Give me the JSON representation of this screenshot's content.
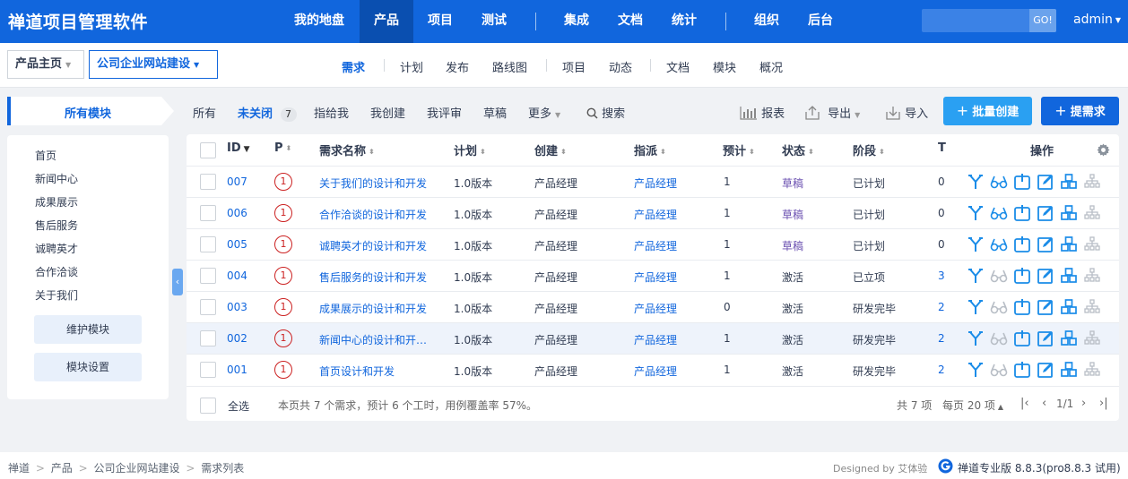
{
  "app": {
    "title": "禅道项目管理软件"
  },
  "topnav": {
    "items": [
      "我的地盘",
      "产品",
      "项目",
      "测试",
      "集成",
      "文档",
      "统计",
      "组织",
      "后台"
    ],
    "active": "产品"
  },
  "search": {
    "placeholder": "",
    "go": "GO!"
  },
  "user": {
    "name": "admin"
  },
  "breadcrumb": {
    "home": "产品主页",
    "product": "公司企业网站建设"
  },
  "subnav": {
    "items": [
      "需求",
      "计划",
      "发布",
      "路线图",
      "项目",
      "动态",
      "文档",
      "模块",
      "概况"
    ],
    "active": "需求"
  },
  "modules": {
    "title": "所有模块",
    "items": [
      "首页",
      "新闻中心",
      "成果展示",
      "售后服务",
      "诚聘英才",
      "合作洽谈",
      "关于我们"
    ],
    "maintain": "维护模块",
    "settings": "模块设置"
  },
  "filters": {
    "all": "所有",
    "unclosed": "未关闭",
    "unclosed_count": "7",
    "assigned": "指给我",
    "created": "我创建",
    "reviewed": "我评审",
    "draft": "草稿",
    "more": "更多",
    "search": "搜索"
  },
  "toolbar": {
    "report": "报表",
    "export": "导出",
    "import": "导入",
    "batch_create": "批量创建",
    "create": "提需求"
  },
  "table": {
    "headers": {
      "id": "ID",
      "p": "P",
      "name": "需求名称",
      "plan": "计划",
      "creator": "创建",
      "assign": "指派",
      "estimate": "预计",
      "status": "状态",
      "stage": "阶段",
      "t": "T",
      "actions": "操作"
    },
    "rows": [
      {
        "id": "007",
        "pri": "1",
        "name": "关于我们的设计和开发",
        "plan": "1.0版本",
        "creator": "产品经理",
        "assign": "产品经理",
        "estimate": "1",
        "status": "草稿",
        "stage": "已计划",
        "t": "0"
      },
      {
        "id": "006",
        "pri": "1",
        "name": "合作洽谈的设计和开发",
        "plan": "1.0版本",
        "creator": "产品经理",
        "assign": "产品经理",
        "estimate": "1",
        "status": "草稿",
        "stage": "已计划",
        "t": "0"
      },
      {
        "id": "005",
        "pri": "1",
        "name": "诚聘英才的设计和开发",
        "plan": "1.0版本",
        "creator": "产品经理",
        "assign": "产品经理",
        "estimate": "1",
        "status": "草稿",
        "stage": "已计划",
        "t": "0"
      },
      {
        "id": "004",
        "pri": "1",
        "name": "售后服务的设计和开发",
        "plan": "1.0版本",
        "creator": "产品经理",
        "assign": "产品经理",
        "estimate": "1",
        "status": "激活",
        "stage": "已立项",
        "t": "3"
      },
      {
        "id": "003",
        "pri": "1",
        "name": "成果展示的设计和开发",
        "plan": "1.0版本",
        "creator": "产品经理",
        "assign": "产品经理",
        "estimate": "0",
        "status": "激活",
        "stage": "研发完毕",
        "t": "2"
      },
      {
        "id": "002",
        "pri": "1",
        "name": "新闻中心的设计和开…",
        "plan": "1.0版本",
        "creator": "产品经理",
        "assign": "产品经理",
        "estimate": "1",
        "status": "激活",
        "stage": "研发完毕",
        "t": "2"
      },
      {
        "id": "001",
        "pri": "1",
        "name": "首页设计和开发",
        "plan": "1.0版本",
        "creator": "产品经理",
        "assign": "产品经理",
        "estimate": "1",
        "status": "激活",
        "stage": "研发完毕",
        "t": "2"
      }
    ],
    "select_all": "全选",
    "summary": "本页共 7 个需求，预计 6 个工时，用例覆盖率 57%。",
    "total": "共 7 项",
    "per_page": "每页 20 项",
    "page": "1/1"
  },
  "statusbar": {
    "crumbs": [
      "禅道",
      "产品",
      "公司企业网站建设",
      "需求列表"
    ],
    "designed": "Designed by 艾体验",
    "version": "禅道专业版 8.8.3(pro8.8.3 试用)"
  },
  "colors": {
    "primary": "#1166dd",
    "priority": "#cc2222",
    "draft": "#6a4fb0"
  },
  "icons": {
    "actions": [
      "split-icon",
      "review-icon",
      "close-icon",
      "edit-icon",
      "create-case-icon",
      "subdivide-icon"
    ]
  }
}
